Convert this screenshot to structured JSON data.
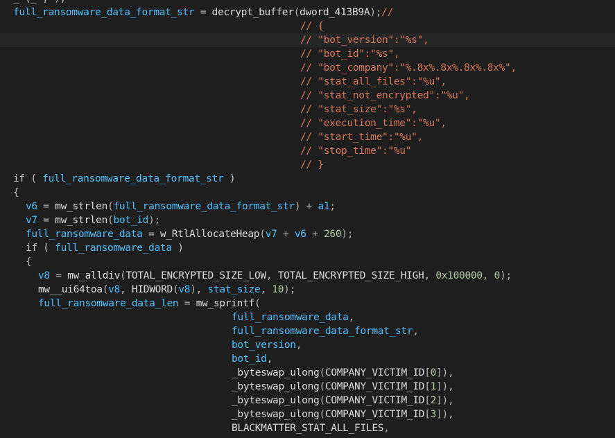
{
  "colors": {
    "background": "#1e1e1e",
    "highlight": "#262626",
    "variable": "#4fc1ff",
    "identifier": "#dcdcdc",
    "keyword": "#c8c8c8",
    "comment": "#d7775b",
    "number": "#b5cea8",
    "punct": "#b4b4b4"
  },
  "lines": [
    {
      "indent": 0,
      "highlight": false,
      "tokens": [
        {
          "t": "_ (",
          "c": "fn"
        },
        {
          "t": "_ ,",
          "c": "pun"
        },
        {
          "t": " );",
          "c": "pun"
        }
      ]
    },
    {
      "indent": 0,
      "highlight": false,
      "tokens": [
        {
          "t": "full_ransomware_data_format_str",
          "c": "var"
        },
        {
          "t": " = ",
          "c": "pun"
        },
        {
          "t": "decrypt_buffer",
          "c": "fn"
        },
        {
          "t": "(",
          "c": "pun"
        },
        {
          "t": "dword_413B9A",
          "c": "gbl"
        },
        {
          "t": ");",
          "c": "pun"
        },
        {
          "t": "//",
          "c": "cmt"
        }
      ]
    },
    {
      "indent": 46,
      "highlight": false,
      "tokens": [
        {
          "t": "// {",
          "c": "cmt"
        }
      ]
    },
    {
      "indent": 46,
      "highlight": true,
      "tokens": [
        {
          "t": "// \"bot_version\":\"%s\",",
          "c": "cmt"
        }
      ]
    },
    {
      "indent": 46,
      "highlight": false,
      "tokens": [
        {
          "t": "// \"bot_id\":\"%s\",",
          "c": "cmt"
        }
      ]
    },
    {
      "indent": 46,
      "highlight": false,
      "tokens": [
        {
          "t": "// \"bot_company\":\"%.8x%.8x%.8x%.8x%\",",
          "c": "cmt"
        }
      ]
    },
    {
      "indent": 46,
      "highlight": false,
      "tokens": [
        {
          "t": "// \"stat_all_files\":\"%u\",",
          "c": "cmt"
        }
      ]
    },
    {
      "indent": 46,
      "highlight": false,
      "tokens": [
        {
          "t": "// \"stat_not_encrypted\":\"%u\",",
          "c": "cmt"
        }
      ]
    },
    {
      "indent": 46,
      "highlight": false,
      "tokens": [
        {
          "t": "// \"stat_size\":\"%s\",",
          "c": "cmt"
        }
      ]
    },
    {
      "indent": 46,
      "highlight": false,
      "tokens": [
        {
          "t": "// \"execution_time\":\"%u\",",
          "c": "cmt"
        }
      ]
    },
    {
      "indent": 46,
      "highlight": false,
      "tokens": [
        {
          "t": "// \"start_time\":\"%u\",",
          "c": "cmt"
        }
      ]
    },
    {
      "indent": 46,
      "highlight": false,
      "tokens": [
        {
          "t": "// \"stop_time\":\"%u\"",
          "c": "cmt"
        }
      ]
    },
    {
      "indent": 46,
      "highlight": false,
      "tokens": [
        {
          "t": "// }",
          "c": "cmt"
        }
      ]
    },
    {
      "indent": 0,
      "highlight": false,
      "tokens": [
        {
          "t": "if ( ",
          "c": "kw"
        },
        {
          "t": "full_ransomware_data_format_str",
          "c": "var"
        },
        {
          "t": " )",
          "c": "kw"
        }
      ]
    },
    {
      "indent": 0,
      "highlight": false,
      "tokens": [
        {
          "t": "{",
          "c": "pun"
        }
      ]
    },
    {
      "indent": 2,
      "highlight": false,
      "tokens": [
        {
          "t": "v6",
          "c": "var"
        },
        {
          "t": " = ",
          "c": "pun"
        },
        {
          "t": "mw_strlen",
          "c": "fn"
        },
        {
          "t": "(",
          "c": "pun"
        },
        {
          "t": "full_ransomware_data_format_str",
          "c": "var"
        },
        {
          "t": ") + ",
          "c": "pun"
        },
        {
          "t": "a1",
          "c": "var"
        },
        {
          "t": ";",
          "c": "pun"
        }
      ]
    },
    {
      "indent": 2,
      "highlight": false,
      "tokens": [
        {
          "t": "v7",
          "c": "var"
        },
        {
          "t": " = ",
          "c": "pun"
        },
        {
          "t": "mw_strlen",
          "c": "fn"
        },
        {
          "t": "(",
          "c": "pun"
        },
        {
          "t": "bot_id",
          "c": "var"
        },
        {
          "t": ");",
          "c": "pun"
        }
      ]
    },
    {
      "indent": 2,
      "highlight": false,
      "tokens": [
        {
          "t": "full_ransomware_data",
          "c": "var"
        },
        {
          "t": " = ",
          "c": "pun"
        },
        {
          "t": "w_RtlAllocateHeap",
          "c": "fn"
        },
        {
          "t": "(",
          "c": "pun"
        },
        {
          "t": "v7",
          "c": "var"
        },
        {
          "t": " + ",
          "c": "pun"
        },
        {
          "t": "v6",
          "c": "var"
        },
        {
          "t": " + ",
          "c": "pun"
        },
        {
          "t": "260",
          "c": "num"
        },
        {
          "t": ");",
          "c": "pun"
        }
      ]
    },
    {
      "indent": 2,
      "highlight": false,
      "tokens": [
        {
          "t": "if ( ",
          "c": "kw"
        },
        {
          "t": "full_ransomware_data",
          "c": "var"
        },
        {
          "t": " )",
          "c": "kw"
        }
      ]
    },
    {
      "indent": 2,
      "highlight": false,
      "tokens": [
        {
          "t": "{",
          "c": "pun"
        }
      ]
    },
    {
      "indent": 4,
      "highlight": false,
      "tokens": [
        {
          "t": "v8",
          "c": "var"
        },
        {
          "t": " = ",
          "c": "pun"
        },
        {
          "t": "mw_alldiv",
          "c": "fn"
        },
        {
          "t": "(",
          "c": "pun"
        },
        {
          "t": "TOTAL_ENCRYPTED_SIZE_LOW",
          "c": "gbl"
        },
        {
          "t": ", ",
          "c": "pun"
        },
        {
          "t": "TOTAL_ENCRYPTED_SIZE_HIGH",
          "c": "gbl"
        },
        {
          "t": ", ",
          "c": "pun"
        },
        {
          "t": "0x100000",
          "c": "num"
        },
        {
          "t": ", ",
          "c": "pun"
        },
        {
          "t": "0",
          "c": "num"
        },
        {
          "t": ");",
          "c": "pun"
        }
      ]
    },
    {
      "indent": 4,
      "highlight": false,
      "tokens": [
        {
          "t": "mw__ui64toa",
          "c": "fn"
        },
        {
          "t": "(",
          "c": "pun"
        },
        {
          "t": "v8",
          "c": "var"
        },
        {
          "t": ", ",
          "c": "pun"
        },
        {
          "t": "HIDWORD",
          "c": "fn"
        },
        {
          "t": "(",
          "c": "pun"
        },
        {
          "t": "v8",
          "c": "var"
        },
        {
          "t": "), ",
          "c": "pun"
        },
        {
          "t": "stat_size",
          "c": "var"
        },
        {
          "t": ", ",
          "c": "pun"
        },
        {
          "t": "10",
          "c": "num"
        },
        {
          "t": ");",
          "c": "pun"
        }
      ]
    },
    {
      "indent": 4,
      "highlight": false,
      "tokens": [
        {
          "t": "full_ransomware_data_len",
          "c": "var"
        },
        {
          "t": " = ",
          "c": "pun"
        },
        {
          "t": "mw_sprintf",
          "c": "fn"
        },
        {
          "t": "(",
          "c": "pun"
        }
      ]
    },
    {
      "indent": 35,
      "highlight": false,
      "tokens": [
        {
          "t": "full_ransomware_data",
          "c": "var"
        },
        {
          "t": ",",
          "c": "pun"
        }
      ]
    },
    {
      "indent": 35,
      "highlight": false,
      "tokens": [
        {
          "t": "full_ransomware_data_format_str",
          "c": "var"
        },
        {
          "t": ",",
          "c": "pun"
        }
      ]
    },
    {
      "indent": 35,
      "highlight": false,
      "tokens": [
        {
          "t": "bot_version",
          "c": "var"
        },
        {
          "t": ",",
          "c": "pun"
        }
      ]
    },
    {
      "indent": 35,
      "highlight": false,
      "tokens": [
        {
          "t": "bot_id",
          "c": "var"
        },
        {
          "t": ",",
          "c": "pun"
        }
      ]
    },
    {
      "indent": 35,
      "highlight": false,
      "tokens": [
        {
          "t": "_byteswap_ulong",
          "c": "fn"
        },
        {
          "t": "(",
          "c": "pun"
        },
        {
          "t": "COMPANY_VICTIM_ID",
          "c": "gbl"
        },
        {
          "t": "[",
          "c": "pun"
        },
        {
          "t": "0",
          "c": "num"
        },
        {
          "t": "]),",
          "c": "pun"
        }
      ]
    },
    {
      "indent": 35,
      "highlight": false,
      "tokens": [
        {
          "t": "_byteswap_ulong",
          "c": "fn"
        },
        {
          "t": "(",
          "c": "pun"
        },
        {
          "t": "COMPANY_VICTIM_ID",
          "c": "gbl"
        },
        {
          "t": "[",
          "c": "pun"
        },
        {
          "t": "1",
          "c": "num"
        },
        {
          "t": "]),",
          "c": "pun"
        }
      ]
    },
    {
      "indent": 35,
      "highlight": false,
      "tokens": [
        {
          "t": "_byteswap_ulong",
          "c": "fn"
        },
        {
          "t": "(",
          "c": "pun"
        },
        {
          "t": "COMPANY_VICTIM_ID",
          "c": "gbl"
        },
        {
          "t": "[",
          "c": "pun"
        },
        {
          "t": "2",
          "c": "num"
        },
        {
          "t": "]),",
          "c": "pun"
        }
      ]
    },
    {
      "indent": 35,
      "highlight": false,
      "tokens": [
        {
          "t": "_byteswap_ulong",
          "c": "fn"
        },
        {
          "t": "(",
          "c": "pun"
        },
        {
          "t": "COMPANY_VICTIM_ID",
          "c": "gbl"
        },
        {
          "t": "[",
          "c": "pun"
        },
        {
          "t": "3",
          "c": "num"
        },
        {
          "t": "]),",
          "c": "pun"
        }
      ]
    },
    {
      "indent": 35,
      "highlight": false,
      "tokens": [
        {
          "t": "BLACKMATTER_STAT_ALL_FILES",
          "c": "gbl"
        },
        {
          "t": ",",
          "c": "pun"
        }
      ]
    },
    {
      "indent": 35,
      "highlight": false,
      "tokens": [
        {
          "t": "_",
          "c": "pun"
        }
      ]
    }
  ]
}
